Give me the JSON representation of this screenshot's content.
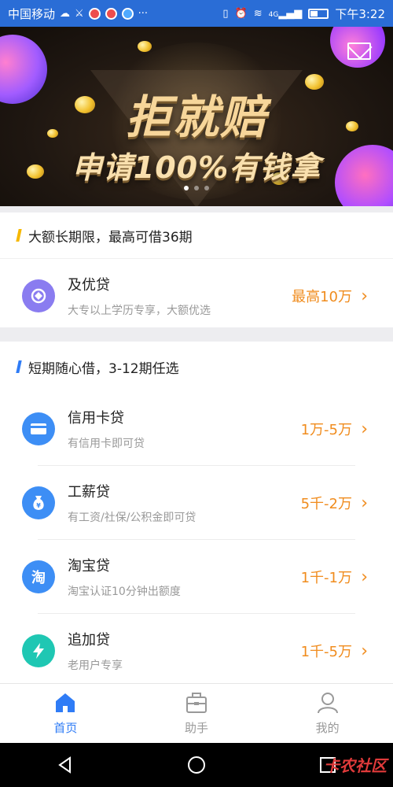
{
  "status_bar": {
    "carrier": "中国移动",
    "time": "下午3:22",
    "network": "4G",
    "icons": [
      "weather-cloud-icon",
      "notification-icon",
      "app-icon-red",
      "app-icon-blue",
      "more-dots-icon",
      "vibrate-icon",
      "alarm-icon",
      "wifi-icon",
      "signal-icon",
      "battery-icon"
    ]
  },
  "banner": {
    "title": "拒就赔",
    "subtitle": "申请100%有钱拿",
    "slide_count": 3,
    "active_slide": 1
  },
  "section1": {
    "header": "大额长期限，最高可借36期",
    "accent": "#f6b800",
    "products": [
      {
        "name": "及优贷",
        "desc": "大专以上学历专享，大额优选",
        "amount": "最高10万",
        "icon": "diamond-icon",
        "color": "#8a7cf0"
      }
    ]
  },
  "section2": {
    "header": "短期随心借，3-12期任选",
    "accent": "#2f7cf6",
    "products": [
      {
        "name": "信用卡贷",
        "desc": "有信用卡即可贷",
        "amount": "1万-5万",
        "icon": "credit-card-icon",
        "color": "#3d8ef5"
      },
      {
        "name": "工薪贷",
        "desc": "有工资/社保/公积金即可贷",
        "amount": "5千-2万",
        "icon": "money-bag-icon",
        "color": "#3d8ef5"
      },
      {
        "name": "淘宝贷",
        "desc": "淘宝认证10分钟出额度",
        "amount": "1千-1万",
        "icon": "taobao-icon",
        "icon_text": "淘",
        "color": "#3d8ef5"
      },
      {
        "name": "追加贷",
        "desc": "老用户专享",
        "amount": "1千-5万",
        "icon": "lightning-icon",
        "color": "#1fc7b3"
      }
    ]
  },
  "bottom_nav": {
    "items": [
      {
        "label": "首页",
        "icon": "home-icon",
        "active": true
      },
      {
        "label": "助手",
        "icon": "briefcase-icon",
        "active": false
      },
      {
        "label": "我的",
        "icon": "profile-icon",
        "active": false
      }
    ],
    "active_color": "#2f7cf6",
    "inactive_color": "#999999"
  },
  "watermark": "卡农社区"
}
